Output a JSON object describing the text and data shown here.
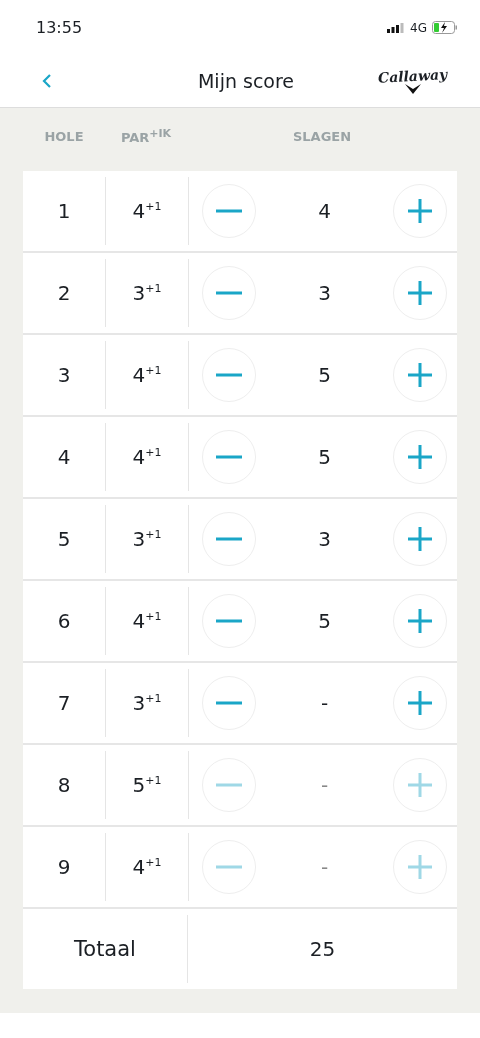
{
  "status_bar": {
    "time": "13:55",
    "network": "4G"
  },
  "nav": {
    "title": "Mijn score",
    "logo": "Callaway"
  },
  "columns": {
    "hole": "HOLE",
    "par": "PAR$^{+IK}$",
    "strokes": "SLAGEN"
  },
  "holes": [
    {
      "hole": "1",
      "par": "4$^{+1}$",
      "strokes": "4",
      "disabled": false
    },
    {
      "hole": "2",
      "par": "3$^{+1}$",
      "strokes": "3",
      "disabled": false
    },
    {
      "hole": "3",
      "par": "4$^{+1}$",
      "strokes": "5",
      "disabled": false
    },
    {
      "hole": "4",
      "par": "4$^{+1}$",
      "strokes": "5",
      "disabled": false
    },
    {
      "hole": "5",
      "par": "3$^{+1}$",
      "strokes": "3",
      "disabled": false
    },
    {
      "hole": "6",
      "par": "4$^{+1}$",
      "strokes": "5",
      "disabled": false
    },
    {
      "hole": "7",
      "par": "3$^{+1}$",
      "strokes": "-",
      "disabled": false
    },
    {
      "hole": "8",
      "par": "5$^{+1}$",
      "strokes": "-",
      "disabled": true
    },
    {
      "hole": "9",
      "par": "4$^{+1}$",
      "strokes": "-",
      "disabled": true
    }
  ],
  "total": {
    "label": "Totaal",
    "value": "25"
  }
}
